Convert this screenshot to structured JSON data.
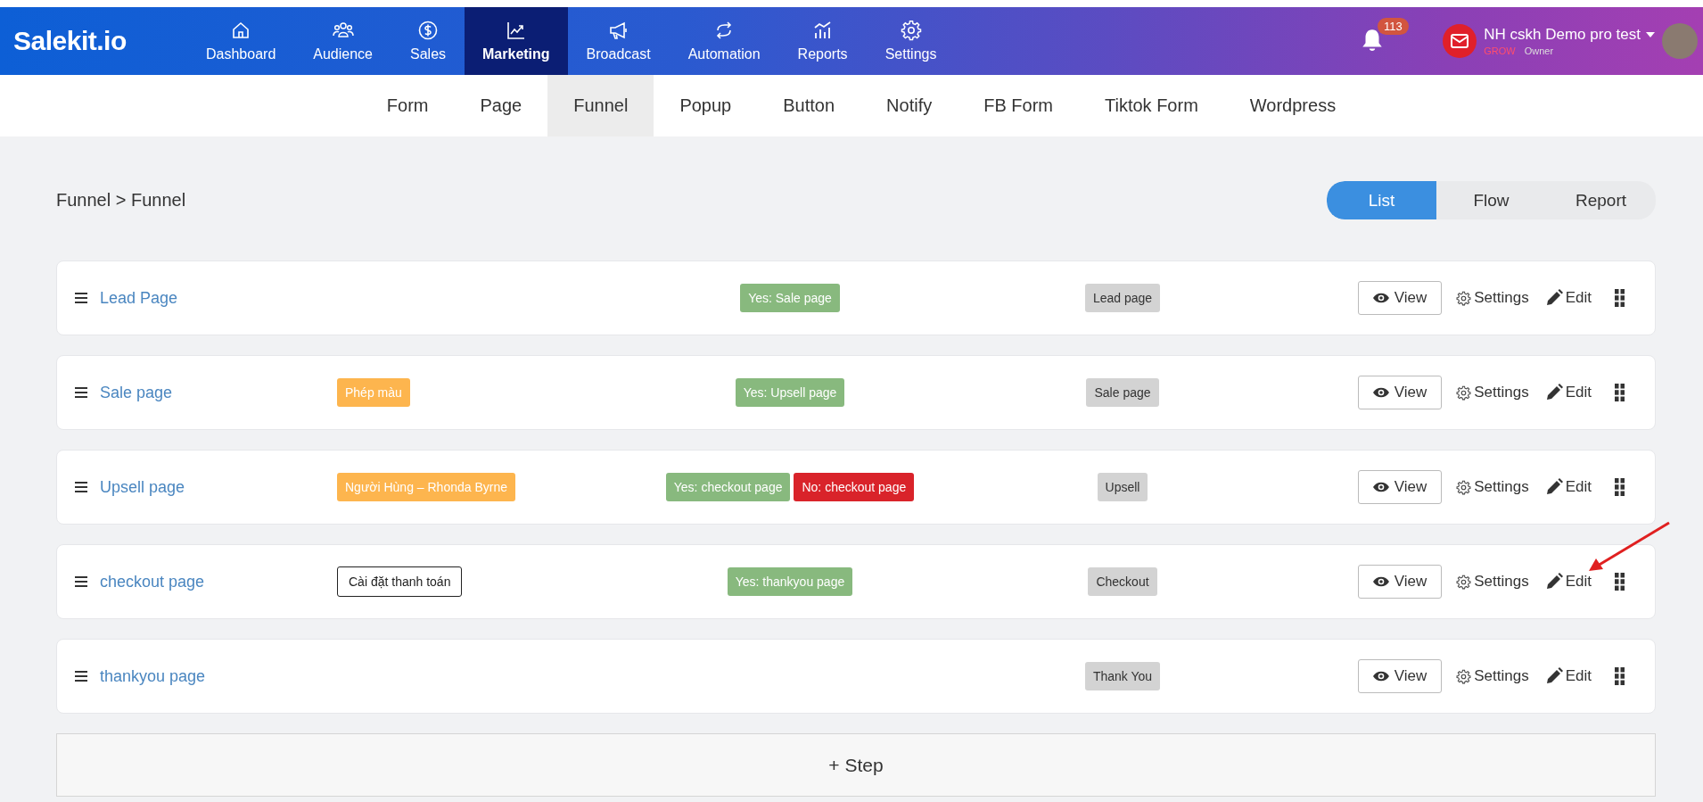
{
  "nav": {
    "logo": "Salekit.io",
    "items": [
      {
        "label": "Dashboard",
        "selected": false
      },
      {
        "label": "Audience",
        "selected": false
      },
      {
        "label": "Sales",
        "selected": false
      },
      {
        "label": "Marketing",
        "selected": true
      },
      {
        "label": "Broadcast",
        "selected": false
      },
      {
        "label": "Automation",
        "selected": false
      },
      {
        "label": "Reports",
        "selected": false
      },
      {
        "label": "Settings",
        "selected": false
      }
    ],
    "notifications": "113",
    "user": {
      "name": "NH cskh Demo pro test",
      "plan": "GROW",
      "role": "Owner"
    }
  },
  "subtabs": [
    {
      "label": "Form",
      "selected": false
    },
    {
      "label": "Page",
      "selected": false
    },
    {
      "label": "Funnel",
      "selected": true
    },
    {
      "label": "Popup",
      "selected": false
    },
    {
      "label": "Button",
      "selected": false
    },
    {
      "label": "Notify",
      "selected": false
    },
    {
      "label": "FB Form",
      "selected": false
    },
    {
      "label": "Tiktok Form",
      "selected": false
    },
    {
      "label": "Wordpress",
      "selected": false
    }
  ],
  "breadcrumb": "Funnel > Funnel",
  "views": [
    {
      "label": "List",
      "selected": true
    },
    {
      "label": "Flow",
      "selected": false
    },
    {
      "label": "Report",
      "selected": false
    }
  ],
  "steps": [
    {
      "name": "Lead Page",
      "branches": [
        {
          "label": "Yes: Sale page",
          "kind": "yes"
        }
      ],
      "type": "Lead page",
      "actions": {
        "view": "View",
        "settings": "Settings",
        "edit": "Edit"
      }
    },
    {
      "name": "Sale page",
      "tags": [
        {
          "label": "Phép màu",
          "kind": "product"
        }
      ],
      "branches": [
        {
          "label": "Yes: Upsell page",
          "kind": "yes"
        }
      ],
      "type": "Sale page",
      "actions": {
        "view": "View",
        "settings": "Settings",
        "edit": "Edit"
      }
    },
    {
      "name": "Upsell page",
      "tags": [
        {
          "label": "Người Hùng – Rhonda Byrne",
          "kind": "product"
        }
      ],
      "branches": [
        {
          "label": "Yes: checkout page",
          "kind": "yes"
        },
        {
          "label": "No: checkout page",
          "kind": "no"
        }
      ],
      "type": "Upsell",
      "actions": {
        "view": "View",
        "settings": "Settings",
        "edit": "Edit"
      }
    },
    {
      "name": "checkout page",
      "tags": [
        {
          "label": "Cài đặt thanh toán",
          "kind": "payment"
        }
      ],
      "branches": [
        {
          "label": "Yes: thankyou page",
          "kind": "yes"
        }
      ],
      "type": "Checkout",
      "actions": {
        "view": "View",
        "settings": "Settings",
        "edit": "Edit"
      }
    },
    {
      "name": "thankyou page",
      "type": "Thank You",
      "actions": {
        "view": "View",
        "settings": "Settings",
        "edit": "Edit"
      }
    }
  ],
  "add_step": "+ Step"
}
